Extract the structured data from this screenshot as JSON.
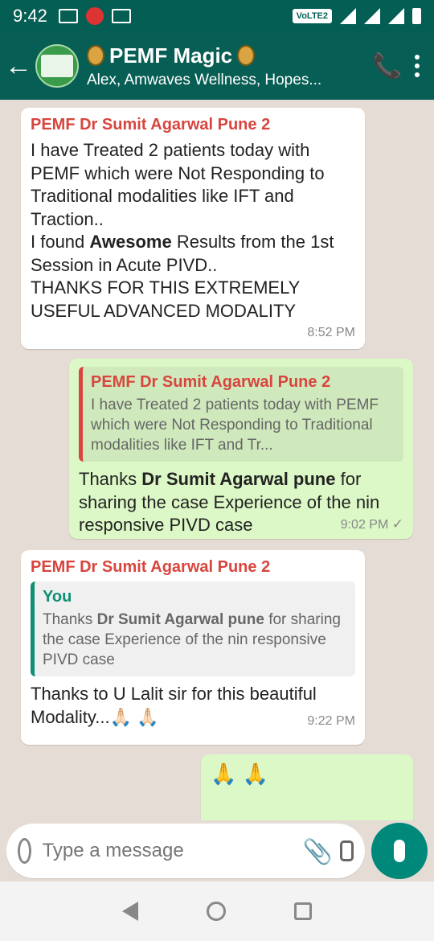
{
  "status": {
    "time": "9:42",
    "volte": "VoLTE2"
  },
  "header": {
    "back_icon": "arrow-left-icon",
    "group_title": "PEMF Magic",
    "group_subtitle": "Alex, Amwaves Wellness, Hopes...",
    "call_icon": "add-call-icon",
    "menu_icon": "more-vert-icon"
  },
  "messages": [
    {
      "direction": "in",
      "sender": "PEMF Dr Sumit Agarwal Pune 2",
      "line1": "I have Treated 2 patients today with PEMF which were Not Responding to Traditional modalities like IFT and Traction..",
      "line2_pre": "I found ",
      "line2_bold": "Awesome",
      "line2_post": " Results from the 1st Session in Acute PIVD..",
      "line3": "THANKS FOR THIS EXTREMELY USEFUL ADVANCED MODALITY",
      "time": "8:52 PM"
    },
    {
      "direction": "out",
      "quote_title": "PEMF Dr Sumit Agarwal Pune 2",
      "quote_text": "I have Treated 2 patients today with PEMF which were Not Responding to Traditional modalities like IFT and Tr...",
      "text_pre": "Thanks ",
      "text_bold": "Dr Sumit Agarwal pune",
      "text_post": " for sharing the case Experience of the nin responsive PIVD case",
      "time": "9:02 PM",
      "status_icon": "check-icon"
    },
    {
      "direction": "in",
      "sender": "PEMF Dr Sumit Agarwal Pune 2",
      "quote_title": "You",
      "quote_pre": "Thanks ",
      "quote_bold": "Dr Sumit Agarwal pune",
      "quote_post": " for sharing the case Experience of the nin responsive PIVD case",
      "text": "Thanks to U Lalit sir  for this beautiful Modality...🙏🏻 🙏🏻",
      "time": "9:22 PM"
    },
    {
      "direction": "out",
      "text": "🙏 🙏"
    }
  ],
  "input": {
    "placeholder": "Type a message",
    "emoji_icon": "emoji-icon",
    "attach_icon": "paperclip-icon",
    "camera_icon": "camera-icon",
    "mic_icon": "mic-icon"
  }
}
